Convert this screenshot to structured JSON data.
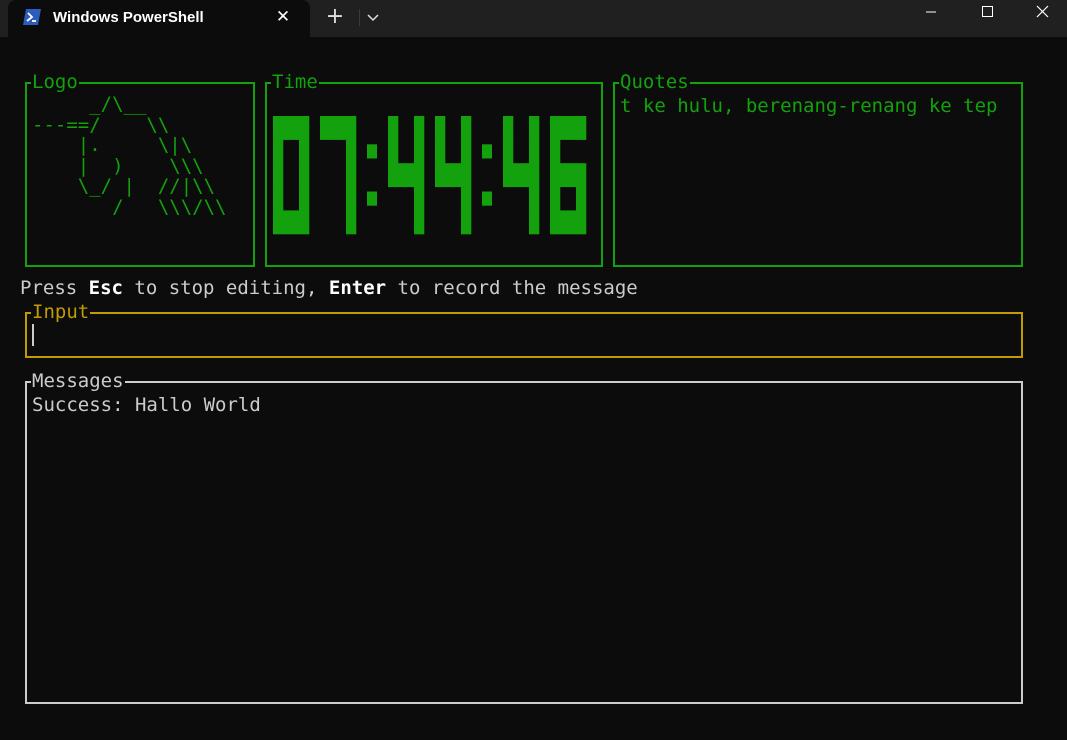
{
  "window": {
    "tab_title": "Windows PowerShell",
    "icons": {
      "app": "powershell-icon",
      "tab_close": "close-icon",
      "new_tab": "plus-icon",
      "dropdown": "chevron-down-icon",
      "minimize": "minimize-icon",
      "maximize": "maximize-icon",
      "close": "close-icon"
    },
    "glyphs": {
      "tab_close": "✕",
      "new_tab": "+"
    }
  },
  "panels": {
    "logo": {
      "title": "Logo",
      "art": "     _/\\__\n---==/    \\\\\n    |.     \\|\\\n    |  )    \\\\\\\n    \\_/ |  //|\\\\\n       /   \\\\\\/\\\\"
    },
    "time": {
      "title": "Time",
      "value": "07:44:46"
    },
    "quotes": {
      "title": "Quotes",
      "text": "t ke hulu, berenang-renang ke tep"
    },
    "input": {
      "title": "Input",
      "value": ""
    },
    "messages": {
      "title": "Messages",
      "items": [
        "Success: Hallo World"
      ]
    }
  },
  "hint": {
    "p1": "Press ",
    "key_esc": "Esc",
    "p2": " to stop editing, ",
    "key_enter": "Enter",
    "p3": " to record the message"
  },
  "colors": {
    "background": "#0c0c0c",
    "titlebar": "#202020",
    "green": "#13a10e",
    "yellow": "#c19c00",
    "white": "#cccccc"
  }
}
